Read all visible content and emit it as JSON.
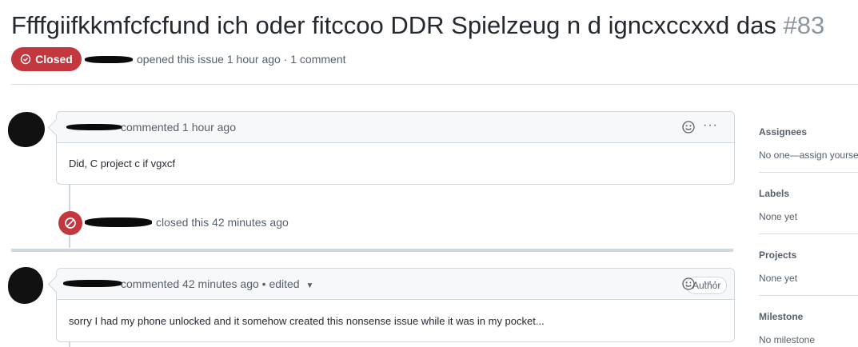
{
  "issue": {
    "title": "Ffffgiifkkmfcfcfund ich oder fitccoo DDR Spielzeug n d igncxccxxd das",
    "number": "#83",
    "state_label": "Closed",
    "meta": "opened this issue 1 hour ago · 1 comment"
  },
  "timeline": {
    "comment1": {
      "header": "commented 1 hour ago",
      "body": "Did, C project c if vgxcf"
    },
    "closed_event": "closed this 42 minutes ago",
    "comment2": {
      "header": "commented 42 minutes ago • edited",
      "author_badge": "Author",
      "body": "sorry I had my phone unlocked and it somehow created this nonsense issue while it was in my pocket..."
    },
    "menu_dots": "···"
  },
  "sidebar": {
    "assignees_label": "Assignees",
    "assignees_value": "No one—assign yourself",
    "labels_label": "Labels",
    "labels_value": "None yet",
    "projects_label": "Projects",
    "projects_value": "None yet",
    "milestone_label": "Milestone",
    "milestone_value": "No milestone"
  },
  "colors": {
    "closed_red": "#c3383f",
    "border": "#d0d7de",
    "muted_text": "#57606a"
  }
}
